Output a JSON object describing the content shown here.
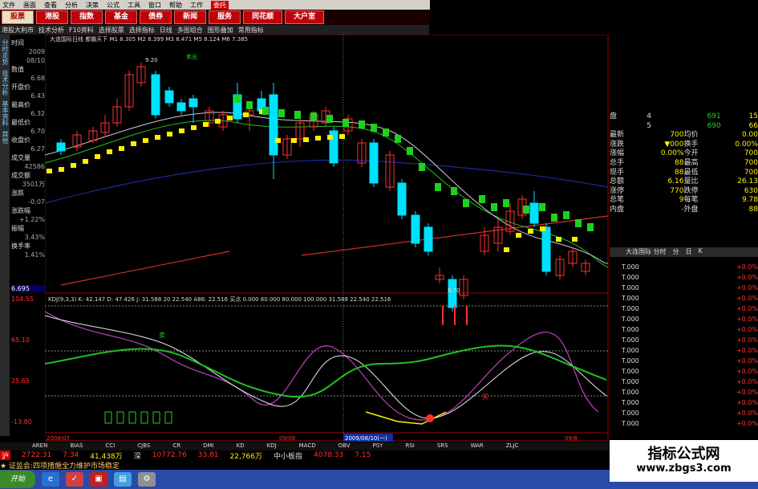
{
  "menu": [
    "文件",
    "画面",
    "查看",
    "分析",
    "决策",
    "公式",
    "工具",
    "窗口",
    "帮助",
    "工作",
    "委托"
  ],
  "nav": [
    "股票",
    "港股",
    "指数",
    "基金",
    "债券",
    "新闻",
    "服务",
    "同花顺",
    "大户室"
  ],
  "toolbar": [
    "港股大利市",
    "技术分析",
    "F10资料",
    "选择股票",
    "选择指标",
    "日线",
    "多图组合",
    "图形叠加",
    "常用指标"
  ],
  "title": "大连国际日线 都霸天下  M1 8.305  M2 8.399  M3 8.471  M5 8.124  M6 7.385",
  "sidebar": [
    "分时走势",
    "技术分析",
    "基本资料",
    "其他"
  ],
  "info_panel": [
    {
      "label": "时间",
      "value": "2009 08/10"
    },
    {
      "label": "数值",
      "value": "6.68"
    },
    {
      "label": "开盘价",
      "value": "6.43"
    },
    {
      "label": "最高价",
      "value": "6.32"
    },
    {
      "label": "最低价",
      "value": "6.70"
    },
    {
      "label": "收盘价",
      "value": "6.27"
    },
    {
      "label": "成交量",
      "value": "42586"
    },
    {
      "label": "成交额",
      "value": "3501万"
    },
    {
      "label": "涨跌",
      "value": "-0.07"
    },
    {
      "label": "涨跌幅",
      "value": "+1.22%"
    },
    {
      "label": "振幅",
      "value": "3.43%"
    },
    {
      "label": "换手率",
      "value": "1.41%"
    }
  ],
  "price_labels": {
    "high": "9.20",
    "low": "6.70",
    "axis": "6.695",
    "buy": "卖出"
  },
  "indicator_header": "KDJ(9,3,3)  K: 42.147  D: 47.426  J: 31.588  20  22.540  A86: 22.516  买点  0.000  60.000  80.000  100.000  31.588  22.540  22.516",
  "indicator_axis": [
    "104.55",
    "65.10",
    "25.65",
    "-13.80"
  ],
  "indicator_marks": {
    "sell": "卖",
    "buy": "买"
  },
  "dates": {
    "start": "2008/07",
    "cursor": "2009/08/10(一)",
    "mid": "09/08",
    "end": "09/8"
  },
  "quote_top": [
    {
      "a": "盘",
      "b": "4",
      "c": "691",
      "d": "15"
    },
    {
      "a": "",
      "b": "5",
      "c": "690",
      "d": "66"
    }
  ],
  "quote": [
    {
      "l1": "最新",
      "v1": "700",
      "l2": "均价",
      "v2": "0.00"
    },
    {
      "l1": "涨跌",
      "v1": "▼000",
      "l2": "换手",
      "v2": "0.00%"
    },
    {
      "l1": "涨幅",
      "v1": "0.00%",
      "l2": "今开",
      "v2": "700"
    },
    {
      "l1": "总手",
      "v1": "88",
      "l2": "最高",
      "v2": "700"
    },
    {
      "l1": "现手",
      "v1": "88",
      "l2": "最低",
      "v2": "700"
    },
    {
      "l1": "总额",
      "v1": "6.16",
      "l2": "量比",
      "v2": "26.13"
    },
    {
      "l1": "涨停",
      "v1": "770",
      "l2": "跌停",
      "v2": "630"
    },
    {
      "l1": "总笔",
      "v1": "9",
      "l2": "每笔",
      "v2": "9.78"
    },
    {
      "l1": "内盘",
      "v1": "-",
      "l2": "外盘",
      "v2": "88"
    }
  ],
  "tick_header": [
    "大连国际 分时",
    "分",
    "日",
    "K"
  ],
  "tick_rows": [
    {
      "t": "T.000",
      "c": "+0.0%"
    },
    {
      "t": "T.000",
      "c": "+0.0%"
    },
    {
      "t": "T.000",
      "c": "+0.0%"
    },
    {
      "t": "T.000",
      "c": "+0.0%"
    },
    {
      "t": "T.000",
      "c": "+0.0%"
    },
    {
      "t": "T.000",
      "c": "+0.0%"
    },
    {
      "t": "T.000",
      "c": "+0.0%"
    },
    {
      "t": "T.000",
      "c": "+0.0%"
    },
    {
      "t": "T.000",
      "c": "+0.0%"
    },
    {
      "t": "T.000",
      "c": "+0.0%"
    },
    {
      "t": "T.000",
      "c": "+0.0%"
    },
    {
      "t": "T.000",
      "c": "+0.0%"
    },
    {
      "t": "T.000",
      "c": "+0.0%"
    },
    {
      "t": "T.000",
      "c": "+0.0%"
    },
    {
      "t": "T.000",
      "c": "+0.0%"
    },
    {
      "t": "T.000",
      "c": "+0.0%"
    }
  ],
  "indicators": [
    "AREN",
    "BIAS",
    "CCI",
    "CJBS",
    "CR",
    "DMI",
    "KD",
    "KDJ",
    "MACD",
    "OBV",
    "PSY",
    "RSI",
    "SRS",
    "WAR",
    "ZLJC"
  ],
  "ticker": {
    "sh_label": "沪",
    "sh_val": "2722.31",
    "sh_chg": "7.34",
    "sh_vol": "41,438万",
    "sz_label": "深",
    "sz_val": "10772.76",
    "sz_chg": "33.81",
    "sz_vol": "22,766万",
    "sme_label": "中小板指",
    "sme_val": "4078.33",
    "sme_chg": "7.15"
  },
  "marquee": "★ 证监会:四项措施全力维护市场稳定",
  "taskbar_start": "开始",
  "watermark": {
    "line1": "指标公式网",
    "line2": "www.zbgs3.com"
  },
  "colors": {
    "up": "#ff3030",
    "down": "#00e0ff",
    "green": "#20d020",
    "yellow": "#ffee00",
    "k": "#e8e8e8",
    "d": "#c040c0",
    "j": "#20c020"
  }
}
